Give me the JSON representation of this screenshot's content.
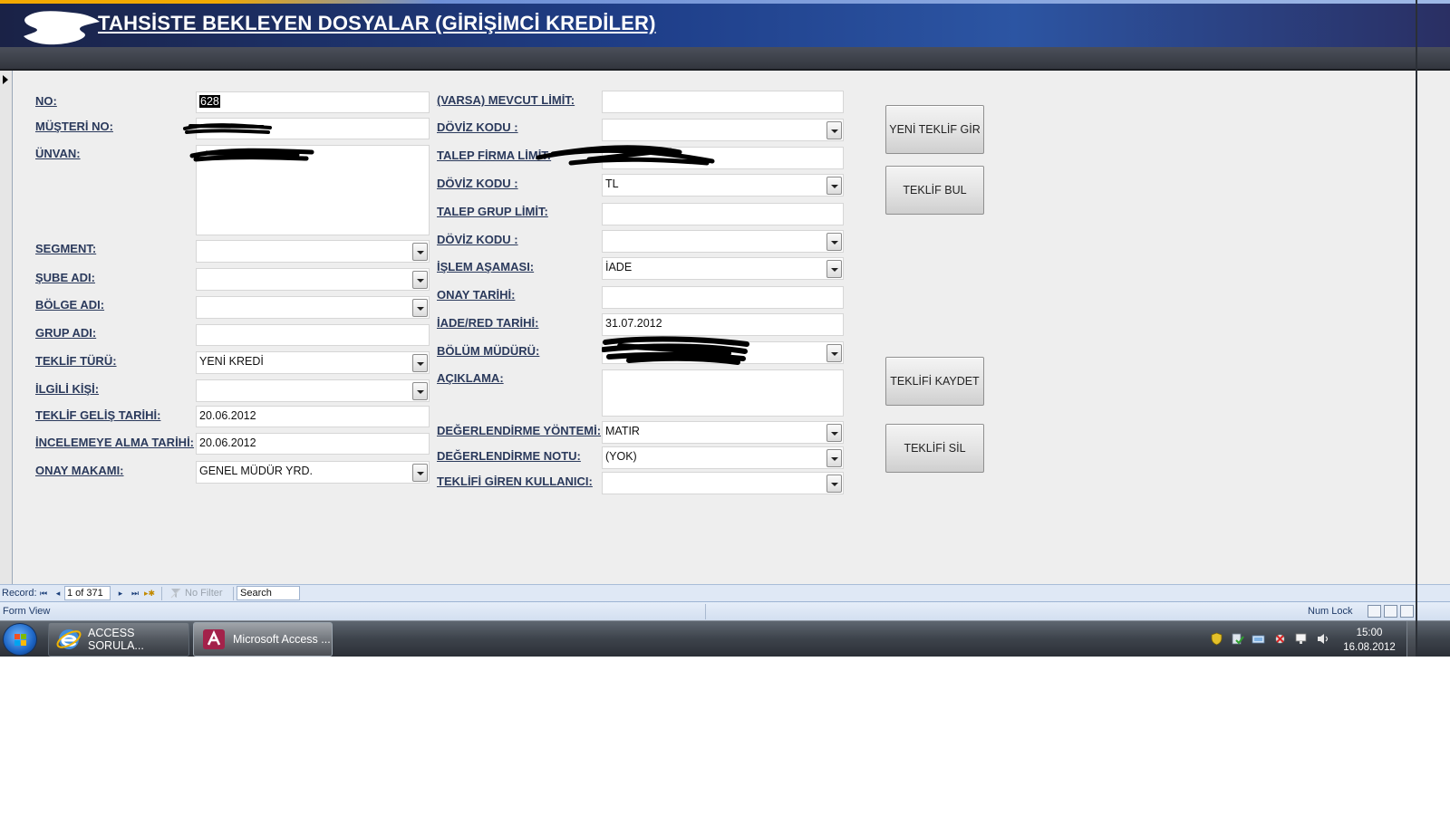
{
  "header": {
    "title": "TAHSİSTE BEKLEYEN DOSYALAR (GİRİŞİMCİ KREDİLER)"
  },
  "form": {
    "left": {
      "no": {
        "label": "NO:",
        "value": "628"
      },
      "musteri_no": {
        "label": "MÜŞTERİ NO:",
        "value": ""
      },
      "unvan": {
        "label": "ÜNVAN:",
        "value": ""
      },
      "segment": {
        "label": "SEGMENT:",
        "value": ""
      },
      "sube_adi": {
        "label": "ŞUBE ADI:",
        "value": ""
      },
      "bolge_adi": {
        "label": "BÖLGE ADI:",
        "value": ""
      },
      "grup_adi": {
        "label": "GRUP ADI:",
        "value": ""
      },
      "teklif_turu": {
        "label": "TEKLİF TÜRÜ:",
        "value": "YENİ KREDİ"
      },
      "ilgili_kisi": {
        "label": "İLGİLİ KİŞİ:",
        "value": ""
      },
      "teklif_gelis_tarihi": {
        "label": "TEKLİF GELİŞ TARİHİ:",
        "value": "20.06.2012"
      },
      "incelemeye_alma_tarihi": {
        "label": "İNCELEMEYE ALMA TARİHİ:",
        "value": "20.06.2012"
      },
      "onay_makami": {
        "label": "ONAY MAKAMI:",
        "value": "GENEL MÜDÜR YRD."
      }
    },
    "middle": {
      "mevcut_limit": {
        "label": "(VARSA) MEVCUT LİMİT:",
        "value": ""
      },
      "doviz_kodu_1": {
        "label": "DÖVİZ KODU :",
        "value": ""
      },
      "talep_firma_limit": {
        "label": "TALEP FİRMA LİMİT:",
        "value": ""
      },
      "doviz_kodu_2": {
        "label": "DÖVİZ KODU :",
        "value": "TL"
      },
      "talep_grup_limit": {
        "label": "TALEP GRUP LİMİT:",
        "value": ""
      },
      "doviz_kodu_3": {
        "label": "DÖVİZ KODU :",
        "value": ""
      },
      "islem_asamasi": {
        "label": "İŞLEM AŞAMASI:",
        "value": "İADE"
      },
      "onay_tarihi": {
        "label": "ONAY TARİHİ:",
        "value": ""
      },
      "iade_red_tarihi": {
        "label": "İADE/RED TARİHİ:",
        "value": "31.07.2012"
      },
      "bolum_muduru": {
        "label": "BÖLÜM MÜDÜRÜ:",
        "value": ""
      },
      "aciklama": {
        "label": "AÇIKLAMA:",
        "value": ""
      },
      "degerlendirme_yontemi": {
        "label": "DEĞERLENDİRME YÖNTEMİ:",
        "value": "MATIR"
      },
      "degerlendirme_notu": {
        "label": "DEĞERLENDİRME NOTU:",
        "value": "(YOK)"
      },
      "teklifi_giren_kullanici": {
        "label": "TEKLİFİ GİREN KULLANICI:",
        "value": ""
      }
    },
    "buttons": {
      "yeni_teklif_gir": "YENİ TEKLİF GİR",
      "teklif_bul": "TEKLİF BUL",
      "teklifi_kaydet": "TEKLİFİ KAYDET",
      "teklifi_sil": "TEKLİFİ SİL"
    }
  },
  "navbar": {
    "record_label": "Record:",
    "position": "1 of 371",
    "filter_label": "No Filter",
    "search_label": "Search"
  },
  "statusbar": {
    "view": "Form View",
    "num_lock": "Num Lock"
  },
  "taskbar": {
    "items": [
      {
        "label": "ACCESS SORULA...",
        "icon": "internet-explorer-icon"
      },
      {
        "label": "Microsoft Access ...",
        "icon": "access-icon"
      }
    ],
    "clock": {
      "time": "15:00",
      "date": "16.08.2012"
    }
  },
  "colors": {
    "header_dark": "#1a2246",
    "header_blue": "#2c55a3",
    "label_text": "#2b3a5c",
    "form_bg": "#eeeeee",
    "navbar_bg": "#dfe8f5"
  }
}
